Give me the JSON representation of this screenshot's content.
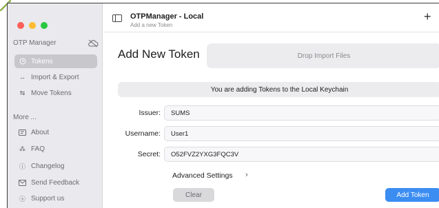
{
  "window": {
    "title": "OTPManager - Local",
    "subtitle": "Add a new Token"
  },
  "sidebar": {
    "header": "OTP Manager",
    "items": [
      {
        "label": "Tokens",
        "icon": "clock-icon",
        "active": true
      },
      {
        "label": "Import & Export",
        "icon": "arrows-icon",
        "active": false
      },
      {
        "label": "Move Tokens",
        "icon": "move-icon",
        "active": false
      }
    ],
    "more_header": "More ...",
    "more_items": [
      {
        "label": "About",
        "icon": "card-icon"
      },
      {
        "label": "FAQ",
        "icon": "faq-icon"
      },
      {
        "label": "Changelog",
        "icon": "info-icon"
      },
      {
        "label": "Send Feedback",
        "icon": "mail-icon"
      },
      {
        "label": "Support us",
        "icon": "support-icon"
      }
    ]
  },
  "main": {
    "title": "Add New Token",
    "drop_label": "Drop Import Files",
    "banner": "You are adding Tokens to the Local Keychain",
    "fields": {
      "issuer_label": "Issuer:",
      "issuer_value": "SUMS",
      "username_label": "Username:",
      "username_value": "User1",
      "secret_label": "Secret:",
      "secret_value": "O52FVZ2YXG3FQC3V"
    },
    "advanced_label": "Advanced Settings",
    "clear_label": "Clear",
    "add_label": "Add Token"
  },
  "colors": {
    "accent": "#3b8df2",
    "sidebar_bg": "#e9e9ee",
    "active_item": "#c8c8cc"
  }
}
